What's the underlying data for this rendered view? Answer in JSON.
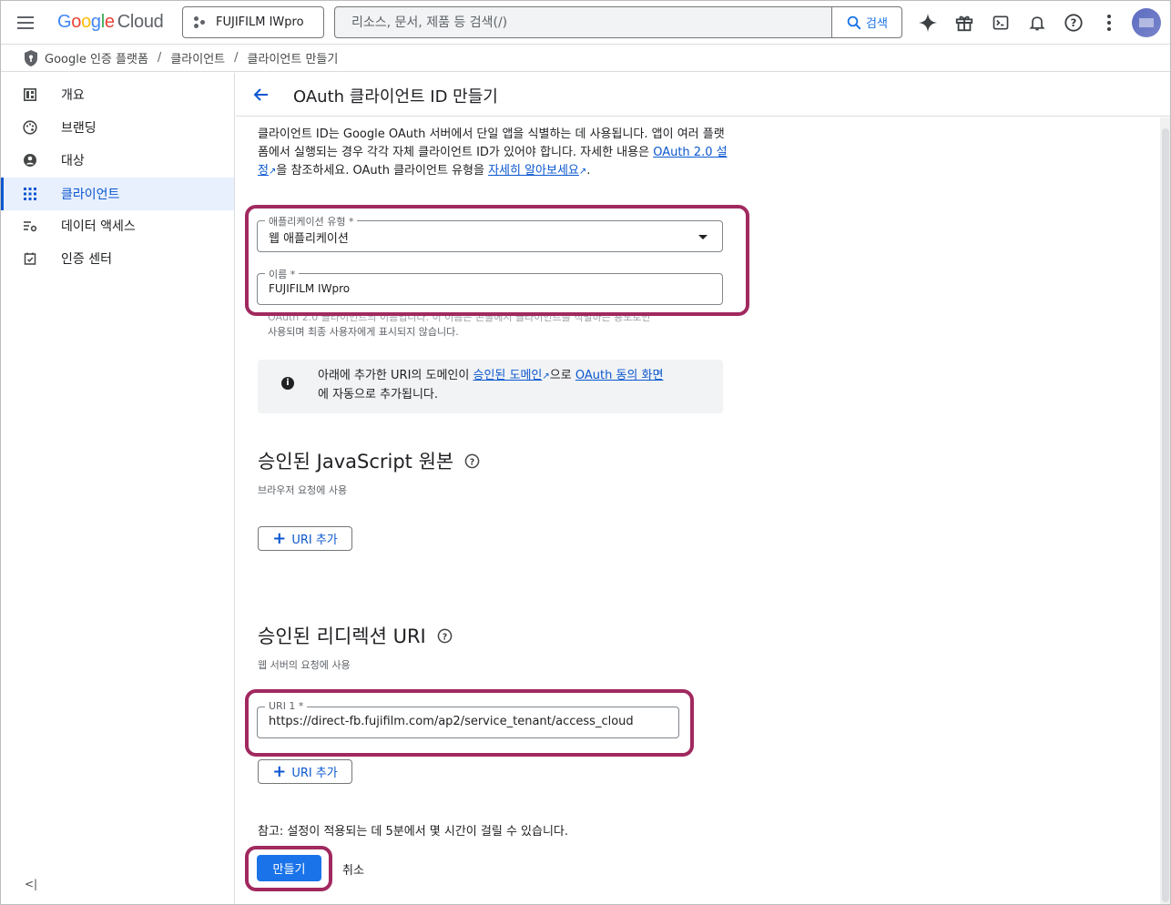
{
  "topbar": {
    "logo_google": "Google",
    "logo_cloud": "Cloud",
    "project": "FUJIFILM IWpro",
    "search_placeholder": "리소스, 문서, 제품 등 검색(/)",
    "search_button": "검색",
    "icons": [
      "menu-icon",
      "gemini-icon",
      "gift-icon",
      "cloud-shell-icon",
      "notifications-icon",
      "help-icon",
      "more-vert-icon",
      "avatar"
    ]
  },
  "breadcrumb": {
    "items": [
      "Google 인증 플랫폼",
      "클라이언트",
      "클라이언트 만들기"
    ],
    "separator": "/"
  },
  "sidebar": {
    "items": [
      {
        "label": "개요",
        "icon": "dashboard-icon"
      },
      {
        "label": "브랜딩",
        "icon": "palette-icon"
      },
      {
        "label": "대상",
        "icon": "person-icon"
      },
      {
        "label": "클라이언트",
        "icon": "apps-icon",
        "active": true
      },
      {
        "label": "데이터 액세스",
        "icon": "data-settings-icon"
      },
      {
        "label": "인증 센터",
        "icon": "verified-icon"
      }
    ],
    "collapse_label": "<|"
  },
  "main": {
    "title": "OAuth 클라이언트 ID 만들기",
    "description": {
      "part1": "클라이언트 ID는 Google OAuth 서버에서 단일 앱을 식별하는 데 사용됩니다. 앱이 여러 플랫폼에서 실행되는 경우 각각 자체 클라이언트 ID가 있어야 합니다. 자세한 내용은 ",
      "link1": "OAuth 2.0 설정",
      "part2": "을 참조하세요. OAuth 클라이언트 유형을 ",
      "link2": "자세히 알아보세요",
      "part3": "."
    },
    "app_type": {
      "label": "애플리케이션 유형 *",
      "value": "웹 애플리케이션"
    },
    "name": {
      "label": "이름 *",
      "value": "FUJIFILM IWpro"
    },
    "name_hint": {
      "line1": "OAuth 2.0 클라이언트의 이름입니다. 이 이름은 콘솔에서 클라이언트를 식별하는 용도로만",
      "line2": "사용되며 최종 사용자에게 표시되지 않습니다."
    },
    "info": {
      "part1": "아래에 추가한 URI의 도메인이 ",
      "link1": "승인된 도메인",
      "part2": "으로 ",
      "link2": "OAuth 동의 화면",
      "part3": "에 자동으로 추가됩니다."
    },
    "js_origins": {
      "title": "승인된 JavaScript 원본",
      "subtitle": "브라우저 요청에 사용",
      "add_button": "URI 추가"
    },
    "redirect_uris": {
      "title": "승인된 리디렉션 URI",
      "subtitle": "웹 서버의 요청에 사용",
      "uri1_label": "URI 1 *",
      "uri1_value": "https://direct-fb.fujifilm.com/ap2/service_tenant/access_cloud",
      "add_button": "URI 추가"
    },
    "note": "참고: 설정이 적용되는 데 5분에서 몇 시간이 걸릴 수 있습니다.",
    "create_button": "만들기",
    "cancel_button": "취소"
  },
  "colors": {
    "accent": "#1a73e8",
    "link": "#0b57d0",
    "highlight": "#a1295f",
    "active_nav_bg": "#e8f0fe"
  }
}
